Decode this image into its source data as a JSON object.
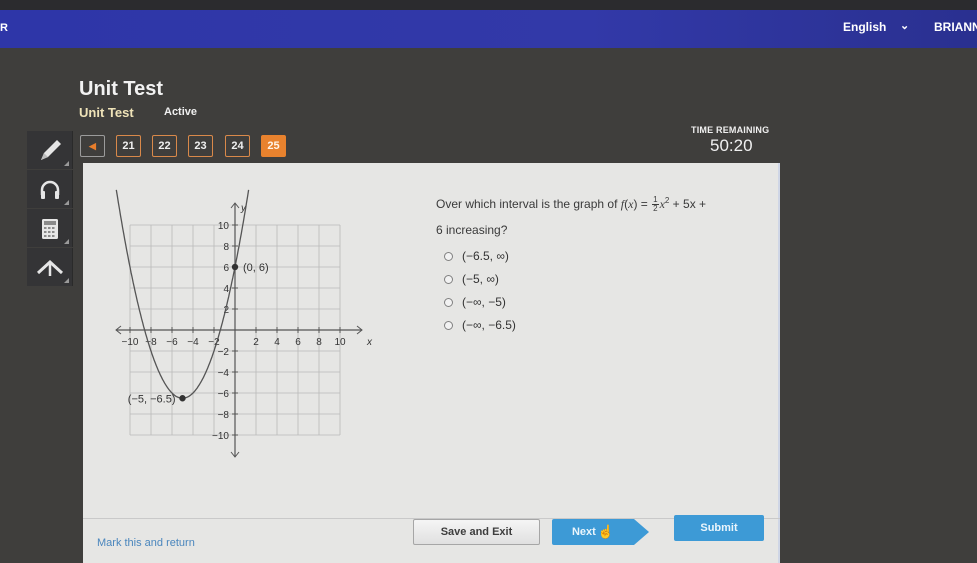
{
  "header": {
    "language": "English",
    "language_chevron": "chevron-down-icon",
    "user_name": "BRIANNA",
    "left_glyph": "R"
  },
  "page": {
    "title": "Unit Test",
    "course": "Unit Test",
    "status": "Active"
  },
  "question_nav": {
    "prev_icon": "caret-left-icon",
    "items": [
      "21",
      "22",
      "23",
      "24",
      "25"
    ],
    "current": "25"
  },
  "timer": {
    "label": "TIME REMAINING",
    "value": "50:20"
  },
  "tools": [
    {
      "name": "pencil",
      "icon": "pencil-icon"
    },
    {
      "name": "headphones",
      "icon": "headphones-icon"
    },
    {
      "name": "calculator",
      "icon": "calculator-icon"
    },
    {
      "name": "reference",
      "icon": "arrow-up-icon"
    }
  ],
  "question": {
    "prefix": "Over which interval is the graph of ",
    "function_name": "f",
    "function_var": "x",
    "frac_num": "1",
    "frac_den": "2",
    "term_x": "x",
    "exp": "2",
    "rest_line1": " + 5x +",
    "line2": "6 increasing?"
  },
  "options": [
    {
      "label": "(−6.5, ∞)",
      "selected": false
    },
    {
      "label": "(−5, ∞)",
      "selected": false
    },
    {
      "label": "(−∞, −5)",
      "selected": false
    },
    {
      "label": "(−∞, −6.5)",
      "selected": false
    }
  ],
  "chart_data": {
    "type": "line",
    "title": "",
    "xlabel": "x",
    "ylabel": "y",
    "xlim": [
      -10,
      10
    ],
    "ylim": [
      -10,
      10
    ],
    "grid": true,
    "x_ticks": [
      "−10",
      "−8",
      "−6",
      "−4",
      "−2",
      "2",
      "4",
      "6",
      "8",
      "10"
    ],
    "x_tick_values": [
      -10,
      -8,
      -6,
      -4,
      -2,
      2,
      4,
      6,
      8,
      10
    ],
    "y_ticks": [
      "10",
      "8",
      "6",
      "4",
      "2",
      "−2",
      "−4",
      "−6",
      "−8",
      "−10"
    ],
    "y_tick_values": [
      10,
      8,
      6,
      4,
      2,
      -2,
      -4,
      -6,
      -8,
      -10
    ],
    "series": [
      {
        "name": "f(x) = 1/2 x^2 + 5x + 6",
        "a": 0.5,
        "b": 5,
        "c": 6
      }
    ],
    "points": [
      {
        "x": 0,
        "y": 6,
        "label": "(0, 6)"
      },
      {
        "x": -5,
        "y": -6.5,
        "label": "(−5, −6.5)"
      }
    ]
  },
  "footer": {
    "mark_return": "Mark this and return",
    "save_exit": "Save and Exit",
    "next": "Next",
    "submit": "Submit"
  }
}
